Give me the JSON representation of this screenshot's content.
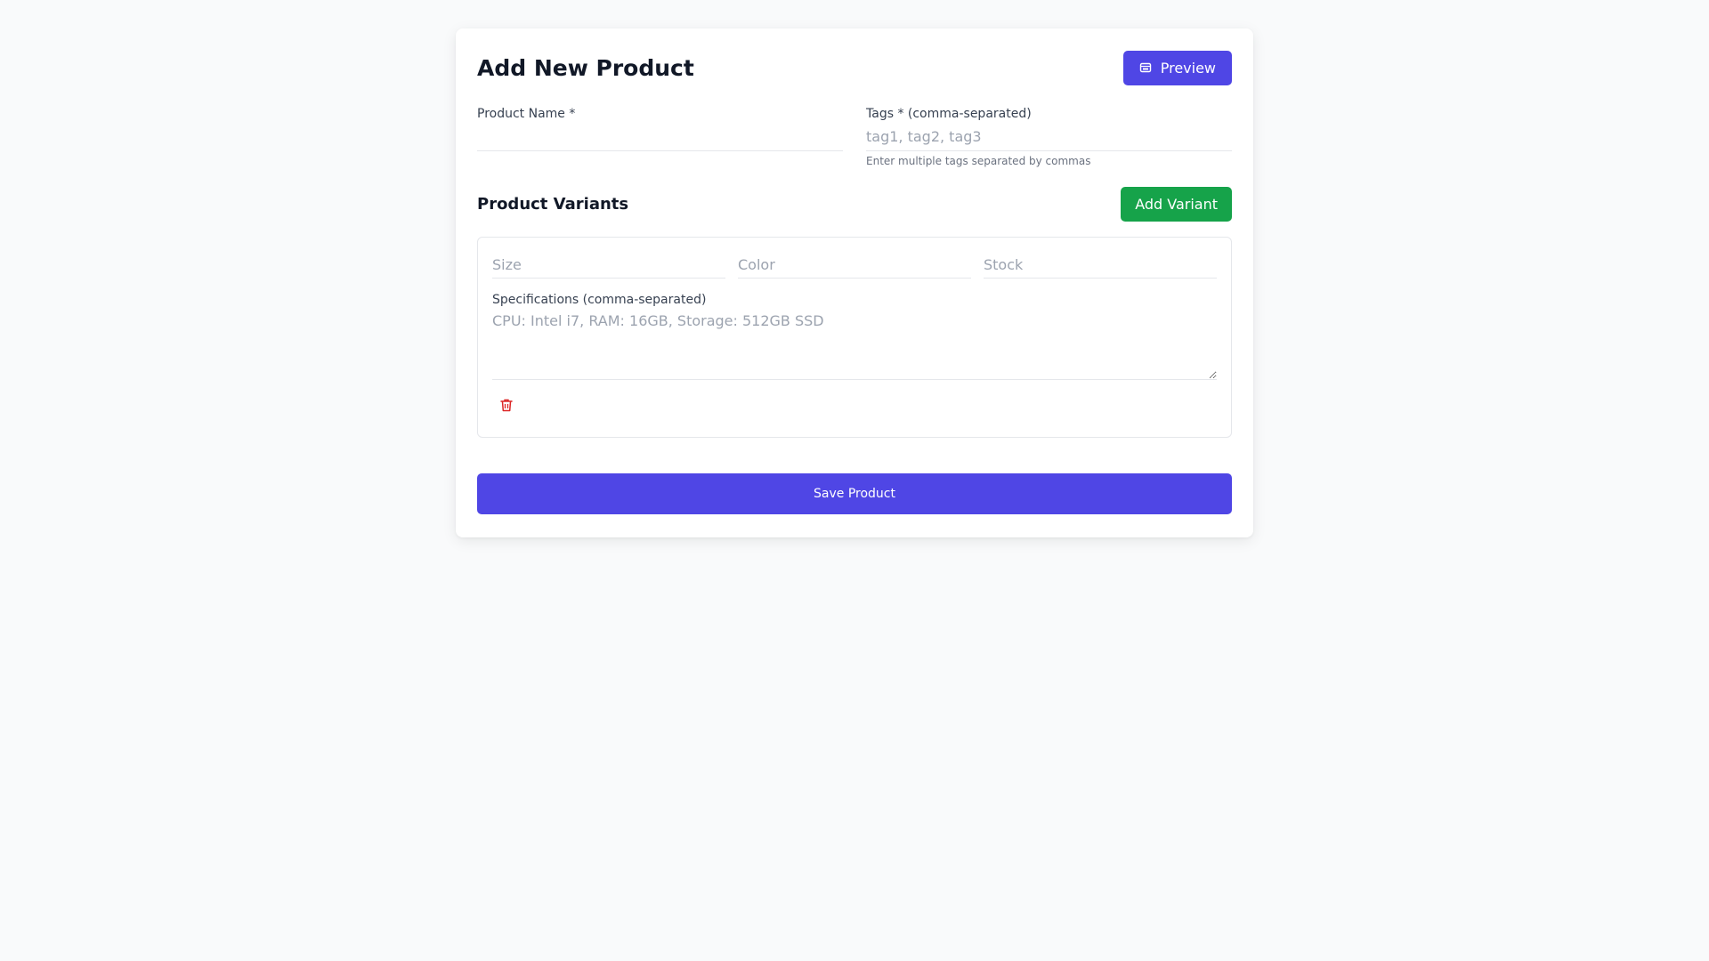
{
  "header": {
    "title": "Add New Product",
    "preview_label": "Preview",
    "preview_icon": "eye-off-icon"
  },
  "form": {
    "product_name": {
      "label": "Product Name *",
      "value": "",
      "placeholder": ""
    },
    "tags": {
      "label": "Tags * (comma-separated)",
      "value": "",
      "placeholder": "tag1, tag2, tag3",
      "help": "Enter multiple tags separated by commas"
    }
  },
  "variants": {
    "title": "Product Variants",
    "add_label": "Add Variant",
    "items": [
      {
        "size_placeholder": "Size",
        "color_placeholder": "Color",
        "stock_placeholder": "Stock",
        "spec_label": "Specifications (comma-separated)",
        "spec_placeholder": "CPU: Intel i7, RAM: 16GB, Storage: 512GB SSD",
        "delete_icon": "trash-icon"
      }
    ]
  },
  "footer": {
    "save_label": "Save Product"
  },
  "colors": {
    "primary": "#4f46e5",
    "success": "#16a34a",
    "danger": "#dc2626",
    "background": "#f9fafb"
  }
}
